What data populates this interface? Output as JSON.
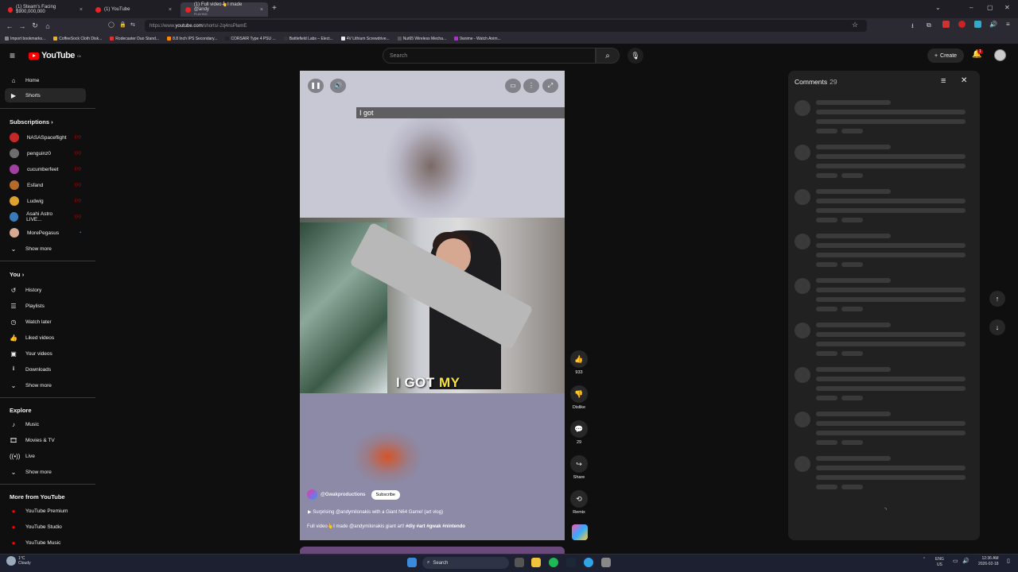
{
  "browser": {
    "tabs": [
      {
        "label": "(1) Steam's Facing $900,000,000",
        "active": false
      },
      {
        "label": "(1) YouTube",
        "active": false
      },
      {
        "label": "(1) Full video👆I made @andy",
        "sublabel": "PLAYING",
        "active": true
      }
    ],
    "url_prefix": "https://www.",
    "url_domain": "youtube.com",
    "url_path": "/shorts/-2q4nsPlamE",
    "bookmarks": [
      "Import bookmarks...",
      "CoffeeSock Cloth Disk...",
      "Rodecaster Duo Stand...",
      "8.8 Inch IPS Secondary...",
      "CORSAIR Type 4 PSU ...",
      "Battlefield Labs – Elect...",
      "4V Lithium Screwdrive...",
      "Nut65 Wireless Mecha...",
      "9anime - Watch Anim..."
    ]
  },
  "header": {
    "logo": "YouTube",
    "region": "CA",
    "search_placeholder": "Search",
    "create_label": "Create",
    "notif_count": "1"
  },
  "sidebar": {
    "main": [
      {
        "label": "Home",
        "icon": "home-icon"
      },
      {
        "label": "Shorts",
        "icon": "shorts-icon",
        "selected": true
      }
    ],
    "subscriptions_title": "Subscriptions",
    "subscriptions": [
      {
        "label": "NASASpaceflight",
        "color": "#c62828"
      },
      {
        "label": "penguinz0",
        "color": "#6d6d6d"
      },
      {
        "label": "cucumberfeet",
        "color": "#a040a0"
      },
      {
        "label": "Esfand",
        "color": "#b46a2a"
      },
      {
        "label": "Ludwig",
        "color": "#e0a030"
      },
      {
        "label": "Asahi Astro LIVE...",
        "color": "#3a7ab8"
      },
      {
        "label": "MorePegasus",
        "color": "#d8a890"
      }
    ],
    "subs_show_more": "Show more",
    "you_title": "You",
    "you_items": [
      {
        "label": "History",
        "icon": "history-icon"
      },
      {
        "label": "Playlists",
        "icon": "playlists-icon"
      },
      {
        "label": "Watch later",
        "icon": "clock-icon"
      },
      {
        "label": "Liked videos",
        "icon": "like-icon"
      },
      {
        "label": "Your videos",
        "icon": "video-icon"
      },
      {
        "label": "Downloads",
        "icon": "download-icon"
      }
    ],
    "you_show_more": "Show more",
    "explore_title": "Explore",
    "explore_items": [
      {
        "label": "Music",
        "icon": "music-icon"
      },
      {
        "label": "Movies & TV",
        "icon": "movies-icon"
      },
      {
        "label": "Live",
        "icon": "live-icon"
      }
    ],
    "explore_show_more": "Show more",
    "more_title": "More from YouTube",
    "more_items": [
      {
        "label": "YouTube Premium"
      },
      {
        "label": "YouTube Studio"
      },
      {
        "label": "YouTube Music"
      }
    ]
  },
  "video": {
    "top_caption": "I got",
    "big_caption_white": "I GOT",
    "big_caption_yellow": "MY",
    "channel": "@Gwakproductions",
    "subscribe_label": "Subscribe",
    "title": "Surprising @andymilonakis with a Giant N64 Game! (art vlog)",
    "desc_plain": "Full video👆I made @andymilonakis giant art! ",
    "desc_tags": "#diy #art #gwak #nintendo"
  },
  "actions": {
    "likes": "933",
    "dislike_label": "Dislike",
    "comments": "29",
    "share_label": "Share",
    "remix_label": "Remix"
  },
  "comments_panel": {
    "title": "Comments",
    "count": "29"
  },
  "taskbar": {
    "temp": "1°C",
    "weather": "Cloudy",
    "search_label": "Search",
    "lang1": "ENG",
    "lang2": "US",
    "time": "12:36 AM",
    "date": "2026-02-18"
  }
}
